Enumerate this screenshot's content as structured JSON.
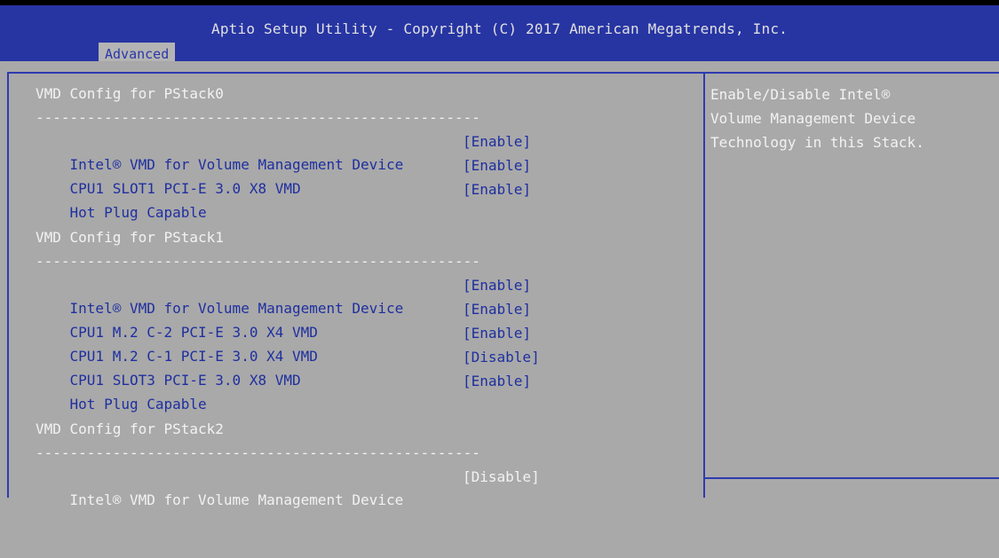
{
  "window": {
    "title": "Aptio Setup Utility - Copyright (C) 2017 American Megatrends, Inc.",
    "active_tab": "Advanced"
  },
  "sections": [
    {
      "header": "VMD Config for PStack0",
      "separator": "----------------------------------------------------",
      "items": [
        {
          "label": "Intel® VMD for Volume Management Device",
          "value": "[Enable]"
        },
        {
          "label": "CPU1 SLOT1 PCI-E 3.0 X8 VMD",
          "value": "[Enable]"
        },
        {
          "label": "Hot Plug Capable",
          "value": "[Enable]"
        }
      ]
    },
    {
      "header": "VMD Config for PStack1",
      "separator": "----------------------------------------------------",
      "items": [
        {
          "label": "Intel® VMD for Volume Management Device",
          "value": "[Enable]"
        },
        {
          "label": "CPU1 M.2 C-2 PCI-E 3.0 X4 VMD",
          "value": "[Enable]"
        },
        {
          "label": "CPU1 M.2 C-1 PCI-E 3.0 X4 VMD",
          "value": "[Enable]"
        },
        {
          "label": "CPU1 SLOT3 PCI-E 3.0 X8 VMD",
          "value": "[Disable]"
        },
        {
          "label": "Hot Plug Capable",
          "value": "[Enable]"
        }
      ]
    },
    {
      "header": "VMD Config for PStack2",
      "separator": "----------------------------------------------------",
      "items": [
        {
          "label": "Intel® VMD for Volume Management Device",
          "value": "[Disable]"
        }
      ]
    }
  ],
  "help": {
    "text": "Enable/Disable Intel®\nVolume Management Device\nTechnology in this Stack."
  },
  "colors": {
    "title_bar": "#2735a3",
    "background": "#a9a9a9",
    "item_text": "#1f2fa0",
    "highlight_text": "#f2f2f2"
  }
}
